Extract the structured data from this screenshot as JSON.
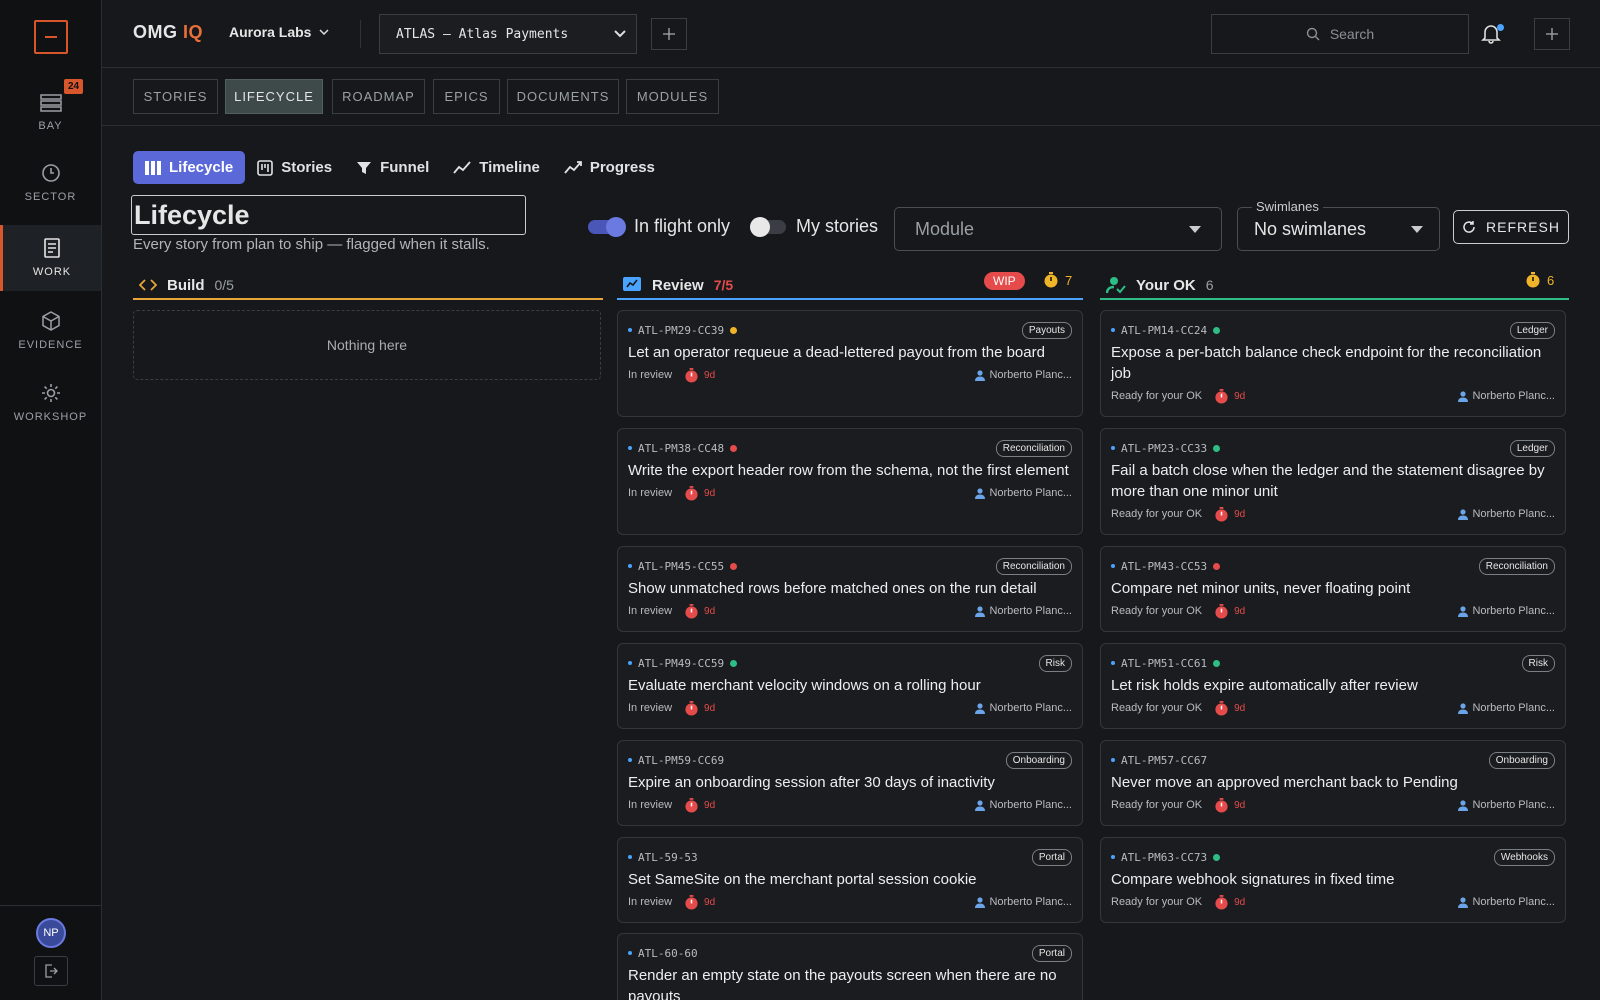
{
  "sidebar": {
    "items": [
      {
        "label": "BAY",
        "badge": "24",
        "icon": "inbox-tray-icon"
      },
      {
        "label": "SECTOR",
        "icon": "clock-icon"
      },
      {
        "label": "WORK",
        "icon": "document-icon",
        "active": true
      },
      {
        "label": "EVIDENCE",
        "icon": "cube-icon"
      },
      {
        "label": "WORKSHOP",
        "icon": "gear-icon"
      }
    ],
    "user_initials": "NP"
  },
  "header": {
    "brand_main": "OMG",
    "brand_accent": "IQ",
    "org": "Aurora Labs",
    "project": "ATLAS — Atlas Payments",
    "search_placeholder": "Search"
  },
  "tabs": [
    "STORIES",
    "LIFECYCLE",
    "ROADMAP",
    "EPICS",
    "DOCUMENTS",
    "MODULES"
  ],
  "active_tab": "LIFECYCLE",
  "views": [
    "Lifecycle",
    "Stories",
    "Funnel",
    "Timeline",
    "Progress"
  ],
  "page": {
    "title": "Lifecycle",
    "subtitle": "Every story from plan to ship — flagged when it stalls."
  },
  "filters": {
    "in_flight_label": "In flight only",
    "in_flight_on": true,
    "my_stories_label": "My stories",
    "my_stories_on": false,
    "module_placeholder": "Module",
    "swimlanes_legend": "Swimlanes",
    "swimlanes_value": "No swimlanes",
    "refresh_label": "REFRESH"
  },
  "columns": {
    "build": {
      "title": "Build",
      "count": "0/5",
      "empty": "Nothing here",
      "color": "#e8a53a"
    },
    "review": {
      "title": "Review",
      "count": "7/5",
      "wip": "WIP",
      "timer": "7",
      "color": "#4aa3ff"
    },
    "ok": {
      "title": "Your OK",
      "count": "6",
      "timer": "6",
      "color": "#2ebd85"
    }
  },
  "review_cards": [
    {
      "id": "ATL-PM29-CC39",
      "dot": "#f0b429",
      "tag": "Payouts",
      "title": "Let an operator requeue a dead-lettered payout from the board",
      "status": "In review",
      "age": "9d",
      "owner": "Norberto Planc..."
    },
    {
      "id": "ATL-PM38-CC48",
      "dot": "#e54b4b",
      "tag": "Reconciliation",
      "title": "Write the export header row from the schema, not the first element",
      "status": "In review",
      "age": "9d",
      "owner": "Norberto Planc..."
    },
    {
      "id": "ATL-PM45-CC55",
      "dot": "#e54b4b",
      "tag": "Reconciliation",
      "title": "Show unmatched rows before matched ones on the run detail",
      "status": "In review",
      "age": "9d",
      "owner": "Norberto Planc..."
    },
    {
      "id": "ATL-PM49-CC59",
      "dot": "#2ebd85",
      "tag": "Risk",
      "title": "Evaluate merchant velocity windows on a rolling hour",
      "status": "In review",
      "age": "9d",
      "owner": "Norberto Planc..."
    },
    {
      "id": "ATL-PM59-CC69",
      "dot": "",
      "tag": "Onboarding",
      "title": "Expire an onboarding session after 30 days of inactivity",
      "status": "In review",
      "age": "9d",
      "owner": "Norberto Planc..."
    },
    {
      "id": "ATL-59-53",
      "dot": "",
      "tag": "Portal",
      "title": "Set SameSite on the merchant portal session cookie",
      "status": "In review",
      "age": "9d",
      "owner": "Norberto Planc..."
    },
    {
      "id": "ATL-60-60",
      "dot": "",
      "tag": "Portal",
      "title": "Render an empty state on the payouts screen when there are no payouts",
      "status": "",
      "age": "",
      "owner": ""
    }
  ],
  "ok_cards": [
    {
      "id": "ATL-PM14-CC24",
      "dot": "#2ebd85",
      "tag": "Ledger",
      "title": "Expose a per-batch balance check endpoint for the reconciliation job",
      "status": "Ready for your OK",
      "age": "9d",
      "owner": "Norberto Planc..."
    },
    {
      "id": "ATL-PM23-CC33",
      "dot": "#2ebd85",
      "tag": "Ledger",
      "title": "Fail a batch close when the ledger and the statement disagree by more than one minor unit",
      "status": "Ready for your OK",
      "age": "9d",
      "owner": "Norberto Planc..."
    },
    {
      "id": "ATL-PM43-CC53",
      "dot": "#e54b4b",
      "tag": "Reconciliation",
      "title": "Compare net minor units, never floating point",
      "status": "Ready for your OK",
      "age": "9d",
      "owner": "Norberto Planc..."
    },
    {
      "id": "ATL-PM51-CC61",
      "dot": "#2ebd85",
      "tag": "Risk",
      "title": "Let risk holds expire automatically after review",
      "status": "Ready for your OK",
      "age": "9d",
      "owner": "Norberto Planc..."
    },
    {
      "id": "ATL-PM57-CC67",
      "dot": "",
      "tag": "Onboarding",
      "title": "Never move an approved merchant back to Pending",
      "status": "Ready for your OK",
      "age": "9d",
      "owner": "Norberto Planc..."
    },
    {
      "id": "ATL-PM63-CC73",
      "dot": "#2ebd85",
      "tag": "Webhooks",
      "title": "Compare webhook signatures in fixed time",
      "status": "Ready for your OK",
      "age": "9d",
      "owner": "Norberto Planc..."
    }
  ]
}
